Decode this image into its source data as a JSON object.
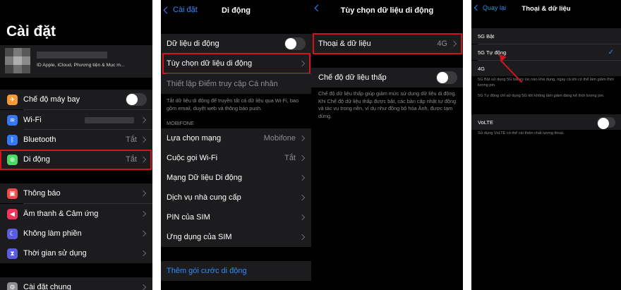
{
  "screen1": {
    "title": "Cài đặt",
    "profile_subtitle": "ID Apple, iCloud, Phương tiện & Mục m...",
    "items": [
      {
        "label": "Chế độ máy bay"
      },
      {
        "label": "Wi-Fi"
      },
      {
        "label": "Bluetooth",
        "value": "Tắt"
      },
      {
        "label": "Di động",
        "value": "Tắt"
      },
      {
        "label": "Thông báo"
      },
      {
        "label": "Âm thanh & Cảm ứng"
      },
      {
        "label": "Không làm phiền"
      },
      {
        "label": "Thời gian sử dụng"
      },
      {
        "label": "Cài đặt chung"
      }
    ]
  },
  "screen2": {
    "back": "Cài đặt",
    "title": "Di động",
    "cellular_data": "Dữ liệu di động",
    "data_options": "Tùy chọn dữ liệu di động",
    "hotspot": "Thiết lập Điểm truy cập Cá nhân",
    "hint": "Tắt dữ liệu di động để truyền tất cả dữ liệu qua Wi-Fi, bao gồm email, duyệt web và thông báo push.",
    "section": "MOBIFONE",
    "network": {
      "label": "Lựa chọn mạng",
      "value": "Mobifone"
    },
    "wifi_call": {
      "label": "Cuộc gọi Wi-Fi",
      "value": "Tắt"
    },
    "network_data": "Mạng Dữ liệu Di động",
    "carrier_services": "Dịch vụ nhà cung cấp",
    "sim_pin": "PIN của SIM",
    "sim_apps": "Ứng dụng của SIM",
    "add_plan": "Thêm gói cước di động"
  },
  "screen3": {
    "title": "Tùy chọn dữ liệu di động",
    "voice_data": {
      "label": "Thoại & dữ liệu",
      "value": "4G"
    },
    "low_data": "Chế độ dữ liệu thấp",
    "hint": "Chế độ dữ liệu thấp giúp giảm mức sử dụng dữ liệu di động. Khi Chế độ dữ liệu thấp được bật, các bản cập nhật tự động và tác vụ trong nền, ví dụ như đồng bộ hóa Ảnh, được tạm dừng."
  },
  "screen4": {
    "back": "Quay lại",
    "title": "Thoại & dữ liệu",
    "options": [
      "5G Bật",
      "5G Tự động",
      "4G"
    ],
    "selected": "5G Tự động",
    "hint1": "5G Bật sử dụng 5G bất kỳ lúc nào khả dụng, ngay cả khi có thể làm giảm thời lượng pin.",
    "hint2": "5G Tự động chỉ sử dụng 5G khi không làm giảm đáng kể thời lượng pin.",
    "volte": "VoLTE",
    "volte_hint": "Sử dụng VoLTE có thể cải thiện chất lượng thoại."
  },
  "colors": {
    "accent": "#2f8bff",
    "highlight": "#d0141c",
    "airplane": "#f19a37",
    "wifi": "#3478f6",
    "bluetooth": "#3478f6",
    "cellular": "#4cd964",
    "notifications": "#f04b4b",
    "sounds": "#f1365b",
    "dnd": "#5c5ce0",
    "screentime": "#5c5ce0",
    "general": "#8e8e93"
  }
}
